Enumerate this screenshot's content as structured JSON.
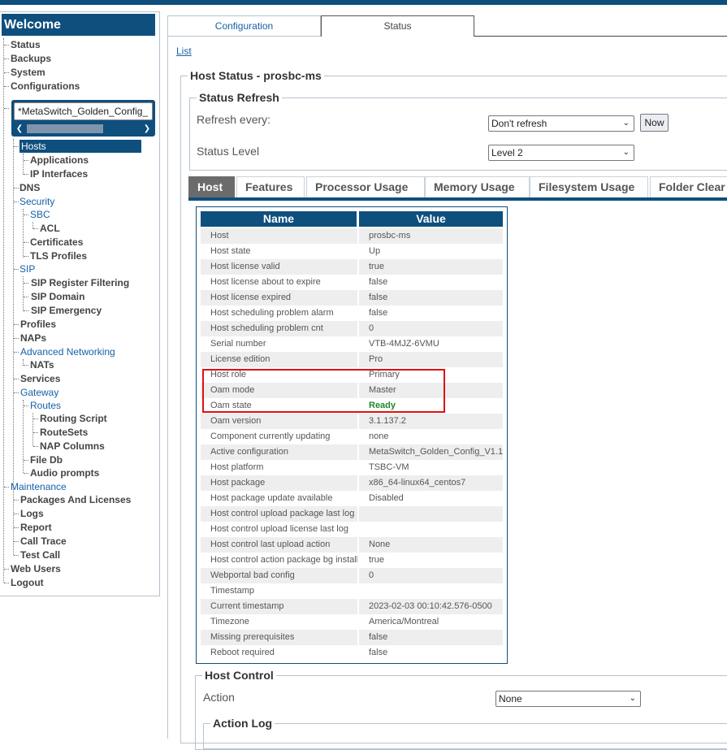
{
  "sidebar": {
    "title": "Welcome",
    "items": {
      "status": "Status",
      "backups": "Backups",
      "system": "System",
      "configurations": "Configurations",
      "config_name": "*MetaSwitch_Golden_Config_",
      "hosts": "Hosts",
      "applications": "Applications",
      "ip_interfaces": "IP Interfaces",
      "dns": "DNS",
      "security": "Security",
      "sbc": "SBC",
      "acl": "ACL",
      "certificates": "Certificates",
      "tls_profiles": "TLS Profiles",
      "sip": "SIP",
      "sip_register_filtering": "SIP Register Filtering",
      "sip_domain": "SIP Domain",
      "sip_emergency": "SIP Emergency",
      "profiles": "Profiles",
      "naps": "NAPs",
      "advanced_networking": "Advanced Networking",
      "nats": "NATs",
      "services": "Services",
      "gateway": "Gateway",
      "routes": "Routes",
      "routing_script": "Routing Script",
      "routesets": "RouteSets",
      "nap_columns": "NAP Columns",
      "file_db": "File Db",
      "audio_prompts": "Audio prompts",
      "maintenance": "Maintenance",
      "packages_and_licenses": "Packages And Licenses",
      "logs": "Logs",
      "report": "Report",
      "call_trace": "Call Trace",
      "test_call": "Test Call",
      "web_users": "Web Users",
      "logout": "Logout"
    }
  },
  "top_tabs": {
    "configuration": "Configuration",
    "status": "Status"
  },
  "list_link": "List",
  "host_status": {
    "title": "Host Status - prosbc-ms",
    "refresh": {
      "title": "Status Refresh",
      "refresh_every_label": "Refresh every:",
      "refresh_every_value": "Don't refresh",
      "now_button": "Now",
      "status_level_label": "Status Level",
      "status_level_value": "Level 2"
    }
  },
  "inner_tabs": [
    "Host",
    "Features",
    "Processor Usage",
    "Memory Usage",
    "Filesystem Usage",
    "Folder Clear"
  ],
  "table": {
    "col_name": "Name",
    "col_value": "Value",
    "rows": [
      {
        "name": "Host",
        "value": "prosbc-ms"
      },
      {
        "name": "Host state",
        "value": "Up"
      },
      {
        "name": "Host license valid",
        "value": "true"
      },
      {
        "name": "Host license about to expire",
        "value": "false"
      },
      {
        "name": "Host license expired",
        "value": "false"
      },
      {
        "name": "Host scheduling problem alarm",
        "value": "false"
      },
      {
        "name": "Host scheduling problem cnt",
        "value": "0"
      },
      {
        "name": "Serial number",
        "value": "VTB-4MJZ-6VMU"
      },
      {
        "name": "License edition",
        "value": "Pro"
      },
      {
        "name": "Host role",
        "value": "Primary"
      },
      {
        "name": "Oam mode",
        "value": "Master"
      },
      {
        "name": "Oam state",
        "value": "Ready"
      },
      {
        "name": "Oam version",
        "value": "3.1.137.2"
      },
      {
        "name": "Component currently updating",
        "value": "none"
      },
      {
        "name": "Active configuration",
        "value": "MetaSwitch_Golden_Config_V1.1"
      },
      {
        "name": "Host platform",
        "value": "TSBC-VM"
      },
      {
        "name": "Host package",
        "value": "x86_64-linux64_centos7"
      },
      {
        "name": "Host package update available",
        "value": "Disabled"
      },
      {
        "name": "Host control upload package last log",
        "value": ""
      },
      {
        "name": "Host control upload license last log",
        "value": ""
      },
      {
        "name": "Host control last upload action",
        "value": "None"
      },
      {
        "name": "Host control action package bg install",
        "value": "true"
      },
      {
        "name": "Webportal bad config",
        "value": "0"
      },
      {
        "name": "Timestamp",
        "value": ""
      },
      {
        "name": "Current timestamp",
        "value": "2023-02-03 00:10:42.576-0500"
      },
      {
        "name": "Timezone",
        "value": "America/Montreal"
      },
      {
        "name": "Missing prerequisites",
        "value": "false"
      },
      {
        "name": "Reboot required",
        "value": "false"
      }
    ]
  },
  "host_control": {
    "title": "Host Control",
    "action_label": "Action",
    "action_value": "None",
    "action_log_title": "Action Log"
  },
  "colors": {
    "brand": "#0e4f7e",
    "link": "#1560a8",
    "ready": "#1d8a2a",
    "highlight": "#e01010"
  }
}
